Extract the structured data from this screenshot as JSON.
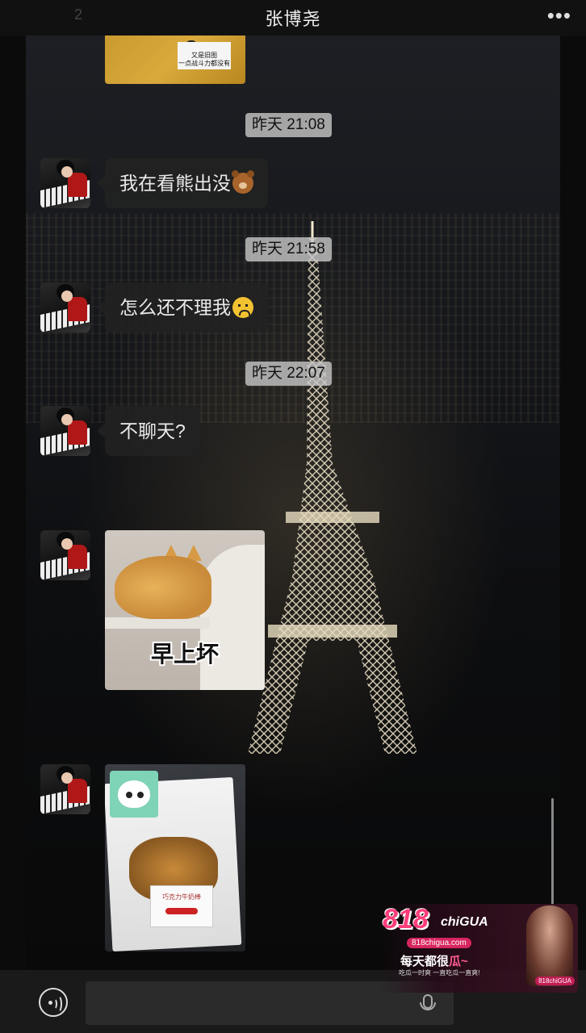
{
  "header": {
    "back_count": "2",
    "title": "张博尧",
    "more": "•••"
  },
  "top_snippet": {
    "note_line1": "又是旧图",
    "note_line2": "一点战斗力都没有"
  },
  "messages": [
    {
      "type": "timestamp",
      "text": "昨天 21:08"
    },
    {
      "type": "text",
      "text": "我在看熊出没",
      "emoji": "bear-face-emoji"
    },
    {
      "type": "timestamp",
      "text": "昨天 21:58"
    },
    {
      "type": "text",
      "text": "怎么还不理我",
      "emoji": "sad-face-emoji"
    },
    {
      "type": "timestamp",
      "text": "昨天 22:07"
    },
    {
      "type": "text",
      "text": "不聊天?"
    },
    {
      "type": "image",
      "caption": "早上坏"
    },
    {
      "type": "image",
      "label_text": "巧克力牛奶棒"
    }
  ],
  "input": {
    "value": "",
    "placeholder": ""
  },
  "ad": {
    "logo_number": "818",
    "logo_word": "chiGUA",
    "domain": "818chigua.com",
    "slogan_prefix": "每天都很",
    "slogan_highlight": "瓜~",
    "sub": "吃瓜一时爽 一直吃瓜一直爽!",
    "badge": "818chiGUA"
  },
  "colors": {
    "bubble": "#222222",
    "timestamp_bg": "#c8c8c8",
    "accent_pink": "#ff3d7a"
  }
}
